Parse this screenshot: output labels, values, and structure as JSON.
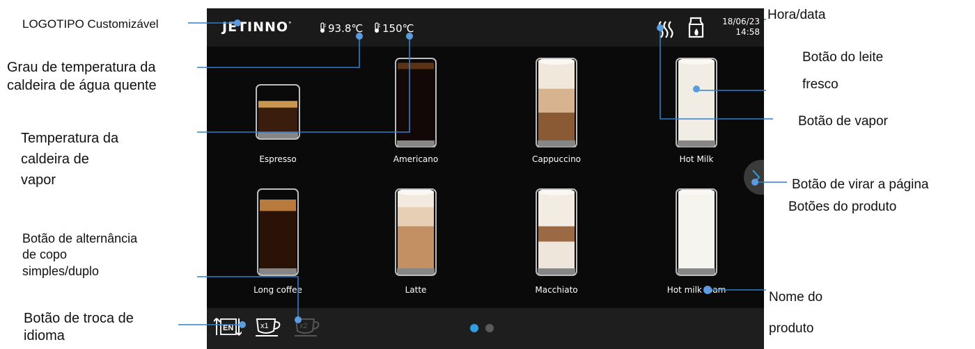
{
  "annotations": {
    "logo": "LOGOTIPO Customizável",
    "hot_water_temp_1": "Grau de temperatura da",
    "hot_water_temp_2": "caldeira de  água quente",
    "steam_temp_1": "Temperatura da",
    "steam_temp_2": "caldeira de",
    "steam_temp_3": "vapor",
    "cup_toggle_1": "Botão de alternância",
    "cup_toggle_2": "de copo",
    "cup_toggle_3": "simples/duplo",
    "language_1": "Botão de troca de",
    "language_2": "idioma",
    "datetime": "Hora/data",
    "fresh_milk_1": "Botão do leite",
    "fresh_milk_2": "fresco",
    "steam_button": "Botão de vapor",
    "page_turn": "Botão de virar a página",
    "product_buttons": "Botões do produto",
    "product_name_1": "Nome do",
    "product_name_2": "produto"
  },
  "screen": {
    "logo_text": "JETINNO",
    "logo_mark": "°",
    "hot_water_temp": "93.8℃",
    "steam_temp": "150℃",
    "date": "18/06/23",
    "time": "14:58",
    "icons": {
      "thermometer": "thermometer-icon",
      "steam": "steam-icon",
      "milk": "milk-carton-icon",
      "language": "language-switch-icon",
      "single_cup": "single-cup-icon",
      "double_cup": "double-cup-icon",
      "page_turn": "chevron-right-icon"
    },
    "cup_single_label": "x1",
    "cup_double_label": "x2",
    "language_label": "EN"
  },
  "products": [
    {
      "name": "Espresso",
      "drink": "espresso"
    },
    {
      "name": "Americano",
      "drink": "americano"
    },
    {
      "name": "Cappuccino",
      "drink": "cappuccino"
    },
    {
      "name": "Hot Milk",
      "drink": "milk"
    },
    {
      "name": "Long coffee",
      "drink": "long"
    },
    {
      "name": "Latte",
      "drink": "latte"
    },
    {
      "name": "Macchiato",
      "drink": "macchiato"
    },
    {
      "name": "Hot milk foam",
      "drink": "foam"
    }
  ],
  "pagination": {
    "current": 1,
    "total": 2
  },
  "colors": {
    "accent": "#2f9fe0",
    "line": "#2f7fd0",
    "dot_inactive": "#5a5a5a"
  }
}
